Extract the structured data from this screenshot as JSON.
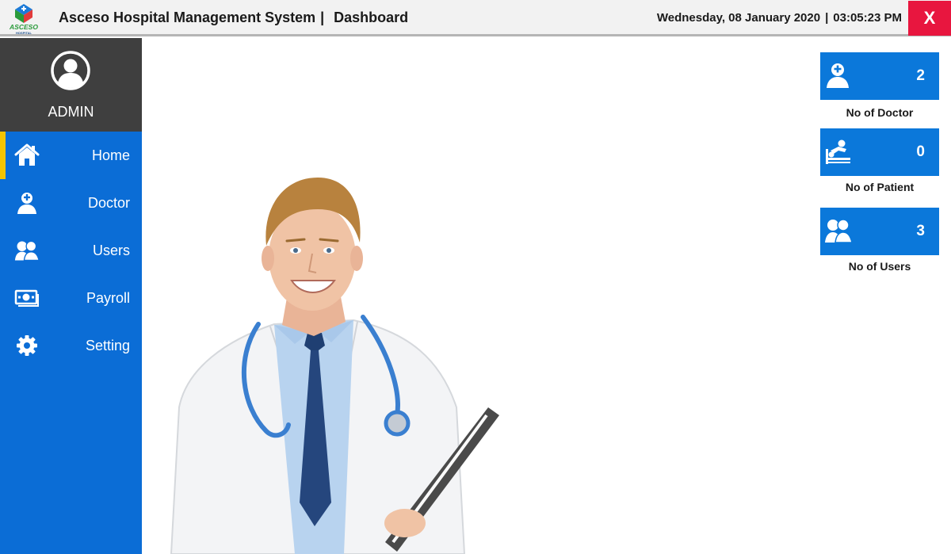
{
  "header": {
    "logo_text": "ASCESO",
    "logo_subtext": "HOSPITAL",
    "app_name": "Asceso Hospital Management System",
    "separator": "|",
    "page_name": "Dashboard",
    "date": "Wednesday, 08 January 2020",
    "time": "03:05:23 PM",
    "close_label": "X"
  },
  "sidebar": {
    "user_label": "ADMIN",
    "items": [
      {
        "label": "Home",
        "icon": "home-icon",
        "active": true
      },
      {
        "label": "Doctor",
        "icon": "doctor-icon",
        "active": false
      },
      {
        "label": "Users",
        "icon": "users-icon",
        "active": false
      },
      {
        "label": "Payroll",
        "icon": "money-icon",
        "active": false
      },
      {
        "label": "Setting",
        "icon": "gear-icon",
        "active": false
      }
    ]
  },
  "stats": [
    {
      "value": "2",
      "label": "No of Doctor",
      "icon": "doctor-icon"
    },
    {
      "value": "0",
      "label": "No of Patient",
      "icon": "patient-bed-icon"
    },
    {
      "value": "3",
      "label": "No of Users",
      "icon": "users-icon"
    }
  ],
  "colors": {
    "sidebar_blue": "#0b6dd6",
    "card_blue": "#0b78da",
    "profile_dark": "#3f3f3f",
    "active_indicator": "#f5c400",
    "close_red": "#e8163f"
  }
}
